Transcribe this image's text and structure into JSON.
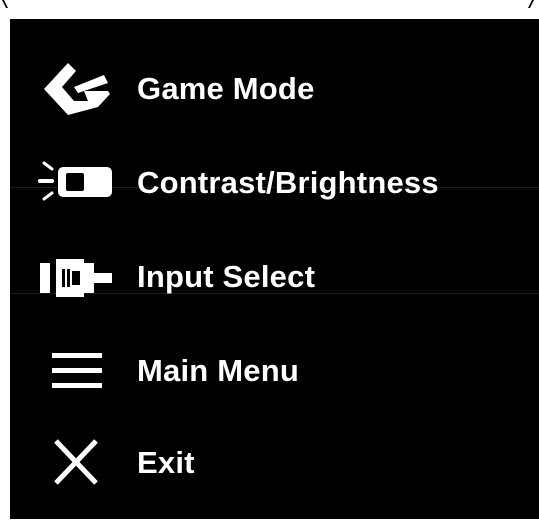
{
  "menu": {
    "items": [
      {
        "label": "Game Mode",
        "icon": "game-mode-icon"
      },
      {
        "label": "Contrast/Brightness",
        "icon": "brightness-icon"
      },
      {
        "label": "Input Select",
        "icon": "input-select-icon"
      },
      {
        "label": "Main Menu",
        "icon": "main-menu-icon"
      },
      {
        "label": "Exit",
        "icon": "exit-icon"
      }
    ]
  },
  "colors": {
    "background": "#000000",
    "text": "#ffffff",
    "frame": "#ffffff"
  }
}
